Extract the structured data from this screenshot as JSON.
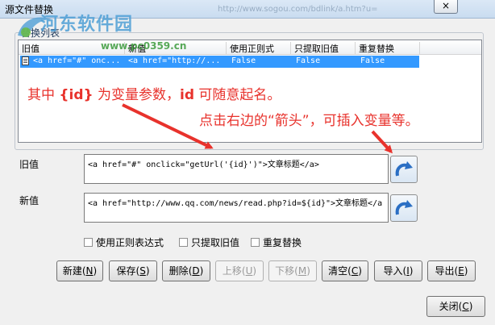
{
  "window": {
    "title": "源文件替换",
    "close_glyph": "×",
    "background_url": "http://www.sogou.com/bdlink/a.htm?u="
  },
  "watermark": {
    "title": "河东软件园",
    "site": "www.pc0359.cn"
  },
  "list": {
    "group_label": "替换列表",
    "columns": [
      "旧值",
      "新值",
      "使用正则式",
      "只提取旧值",
      "重复替换"
    ],
    "rows": [
      {
        "old": "<a href=\"#\" onc...",
        "new": "<a href=\"http://...",
        "regex": "False",
        "extract": "False",
        "repeat": "False"
      }
    ]
  },
  "annotations": {
    "line1_pre": "其中 ",
    "line1_token": "{id}",
    "line1_mid": " 为变量参数，",
    "line1_key": "id",
    "line1_post": " 可随意起名。",
    "line2": "点击右边的“箭头”，可插入变量等。"
  },
  "fields": {
    "old_label": "旧值",
    "old_value": "<a href=\"#\" onclick=\"getUrl('{id}')\">文章标题</a>",
    "new_label": "新值",
    "new_value": "<a href=\"http://www.qq.com/news/read.php?id=${id}\">文章标题</a"
  },
  "options": {
    "regex": "使用正则表达式",
    "extract_old": "只提取旧值",
    "repeat": "重复替换"
  },
  "buttons": {
    "new": "新建",
    "new_key": "N",
    "save": "保存",
    "save_key": "S",
    "delete": "删除",
    "delete_key": "D",
    "up": "上移",
    "up_key": "U",
    "down": "下移",
    "down_key": "M",
    "clear": "清空",
    "clear_key": "C",
    "import": "导入",
    "import_key": "I",
    "export": "导出",
    "export_key": "E",
    "close": "关闭",
    "close_key": "C"
  },
  "colors": {
    "annotation": "#e8322c",
    "selection": "#3399ff",
    "arrow_icon": "#2b6fc4"
  }
}
